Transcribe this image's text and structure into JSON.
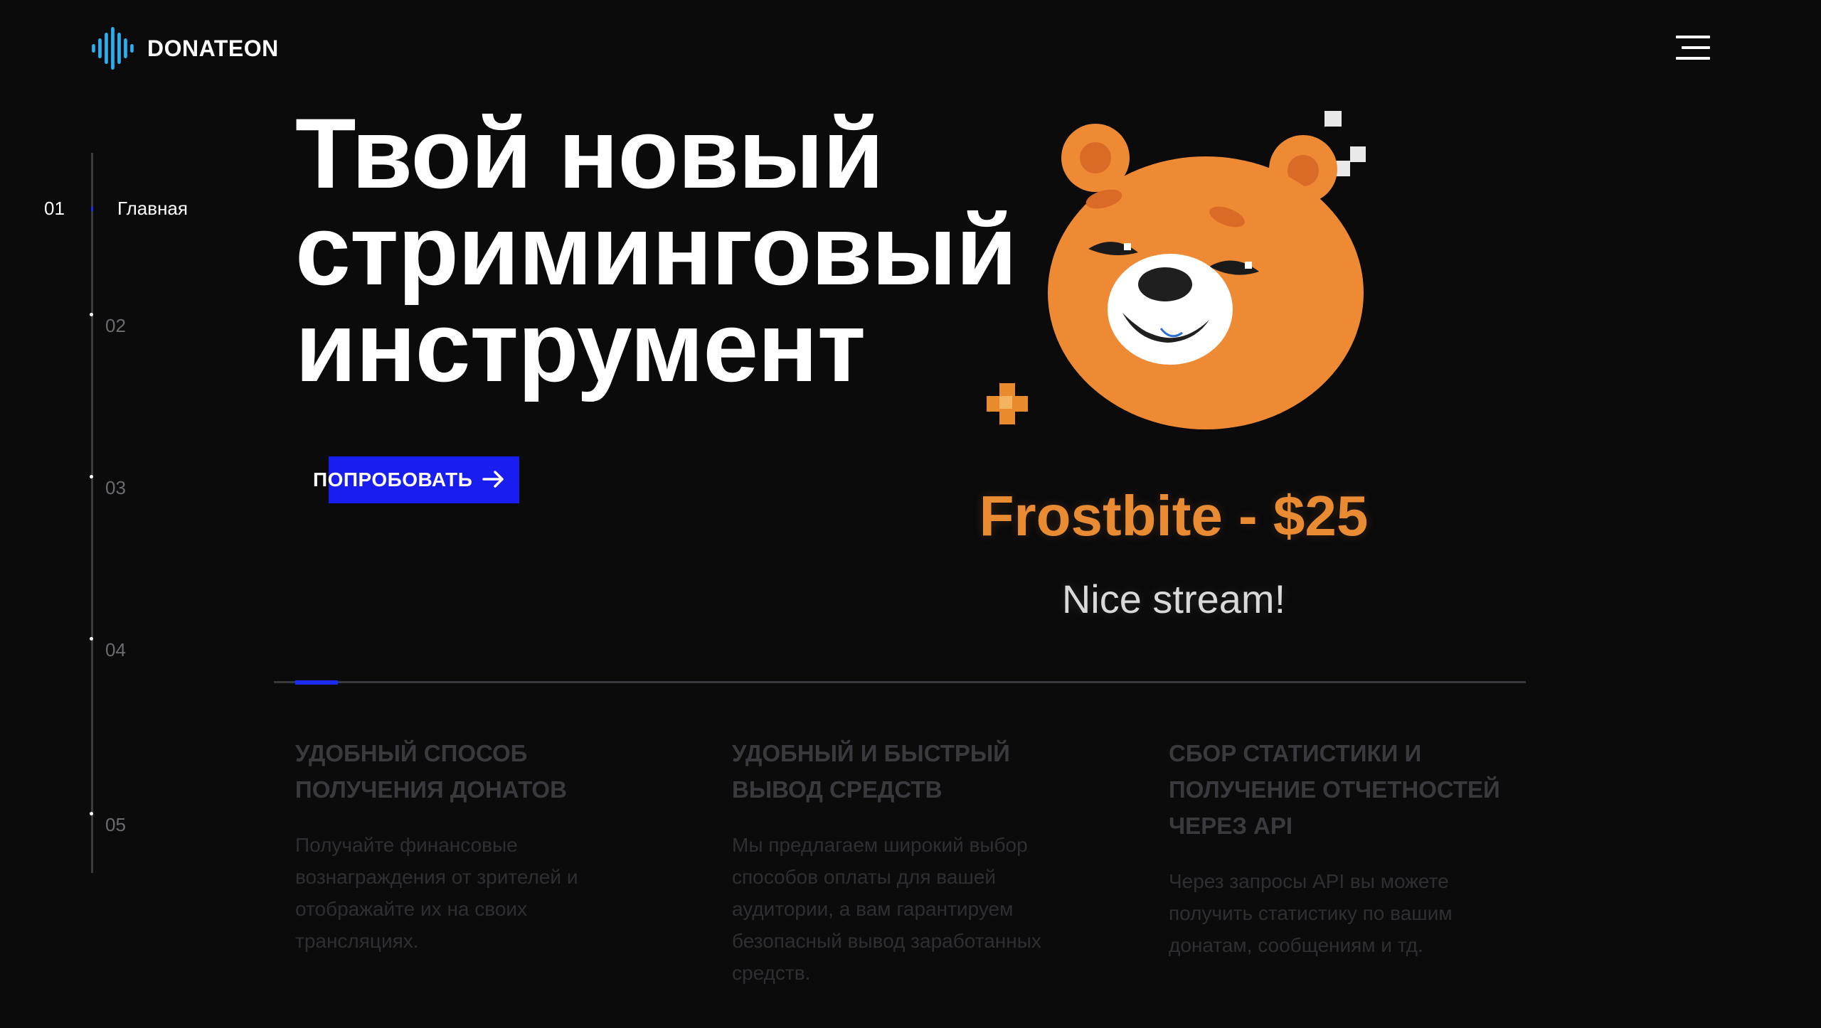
{
  "header": {
    "brand": "DONATEON",
    "logo_icon": "soundwave-logo-icon",
    "menu_icon": "hamburger-menu-icon"
  },
  "sidenav": {
    "items": [
      {
        "number": "01",
        "label": "Главная",
        "active": true
      },
      {
        "number": "02"
      },
      {
        "number": "03"
      },
      {
        "number": "04"
      },
      {
        "number": "05"
      }
    ],
    "active_color": "#1c2bf2"
  },
  "hero": {
    "title_lines": [
      "Твой новый",
      "стриминговый",
      "инструмент"
    ],
    "cta_label": "ПОПРОБОВАТЬ",
    "cta_icon": "arrow-right-icon",
    "accent": "#1a1df0"
  },
  "donation": {
    "mascot": "bear-mascot",
    "donor_line": "Frostbite - $25",
    "message": "Nice stream!",
    "donor_color": "#e98b33"
  },
  "features": [
    {
      "title": "УДОБНЫЙ СПОСОБ ПОЛУЧЕНИЯ ДОНАТОВ",
      "text": "Получайте финансовые вознаграждения от зрителей и отображайте их на своих трансляциях."
    },
    {
      "title": "УДОБНЫЙ И БЫСТРЫЙ ВЫВОД СРЕДСТВ",
      "text": "Мы предлагаем широкий выбор способов оплаты для вашей аудитории, а вам гарантируем безопасный вывод заработанных средств."
    },
    {
      "title": "СБОР СТАТИСТИКИ И ПОЛУЧЕНИЕ ОТЧЕТНОСТЕЙ ЧЕРЕЗ API",
      "text": "Через запросы API вы можете получить статистику по вашим донатам, сообщениям и тд."
    }
  ]
}
